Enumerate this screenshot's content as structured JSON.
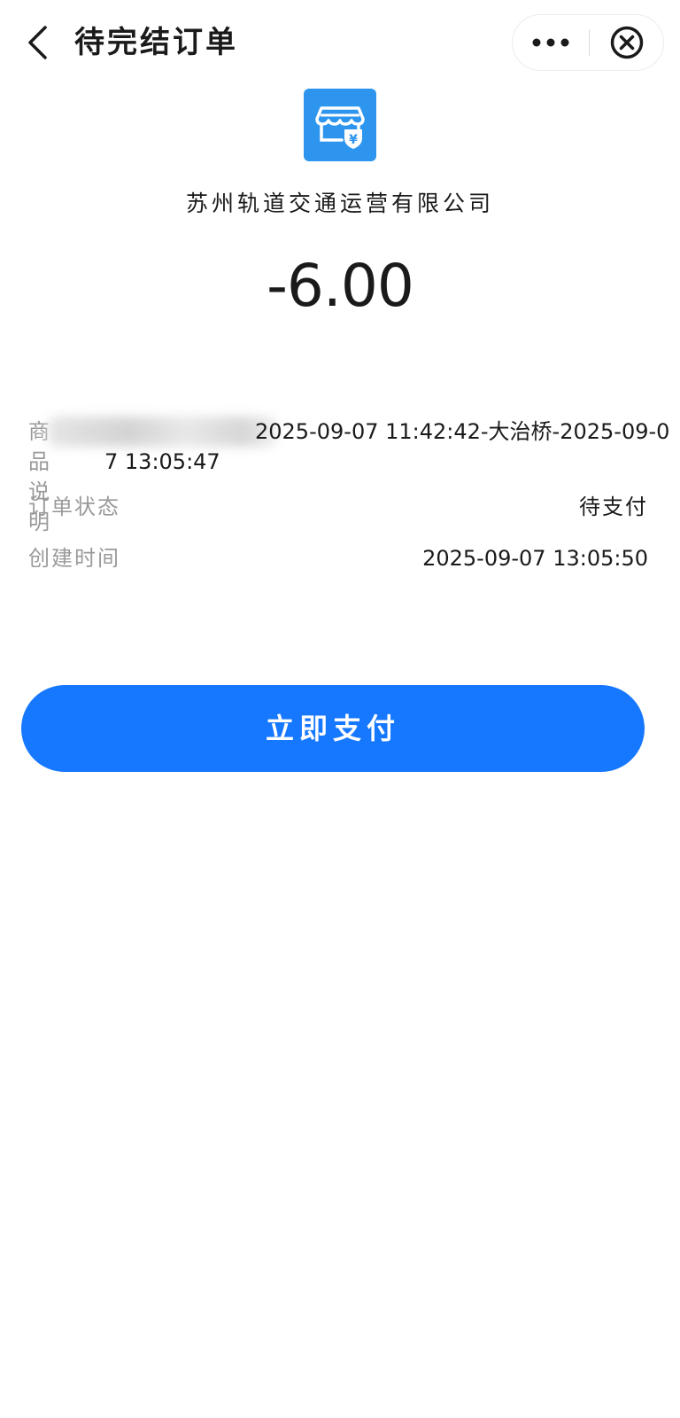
{
  "nav": {
    "title": "待完结订单"
  },
  "merchant": {
    "name": "苏州轨道交通运营有限公司",
    "logo_icon": "store-yuan-icon",
    "logo_color": "#2e95ee"
  },
  "order": {
    "amount": "-6.00",
    "desc_label": "商品说明",
    "desc_value": "2025-09-07 11:42:42-大治桥-2025-09-07 13:05:47",
    "status_label": "订单状态",
    "status_value": "待支付",
    "created_label": "创建时间",
    "created_value": "2025-09-07 13:05:50"
  },
  "actions": {
    "pay_label": "立即支付",
    "pay_color": "#1677ff"
  }
}
